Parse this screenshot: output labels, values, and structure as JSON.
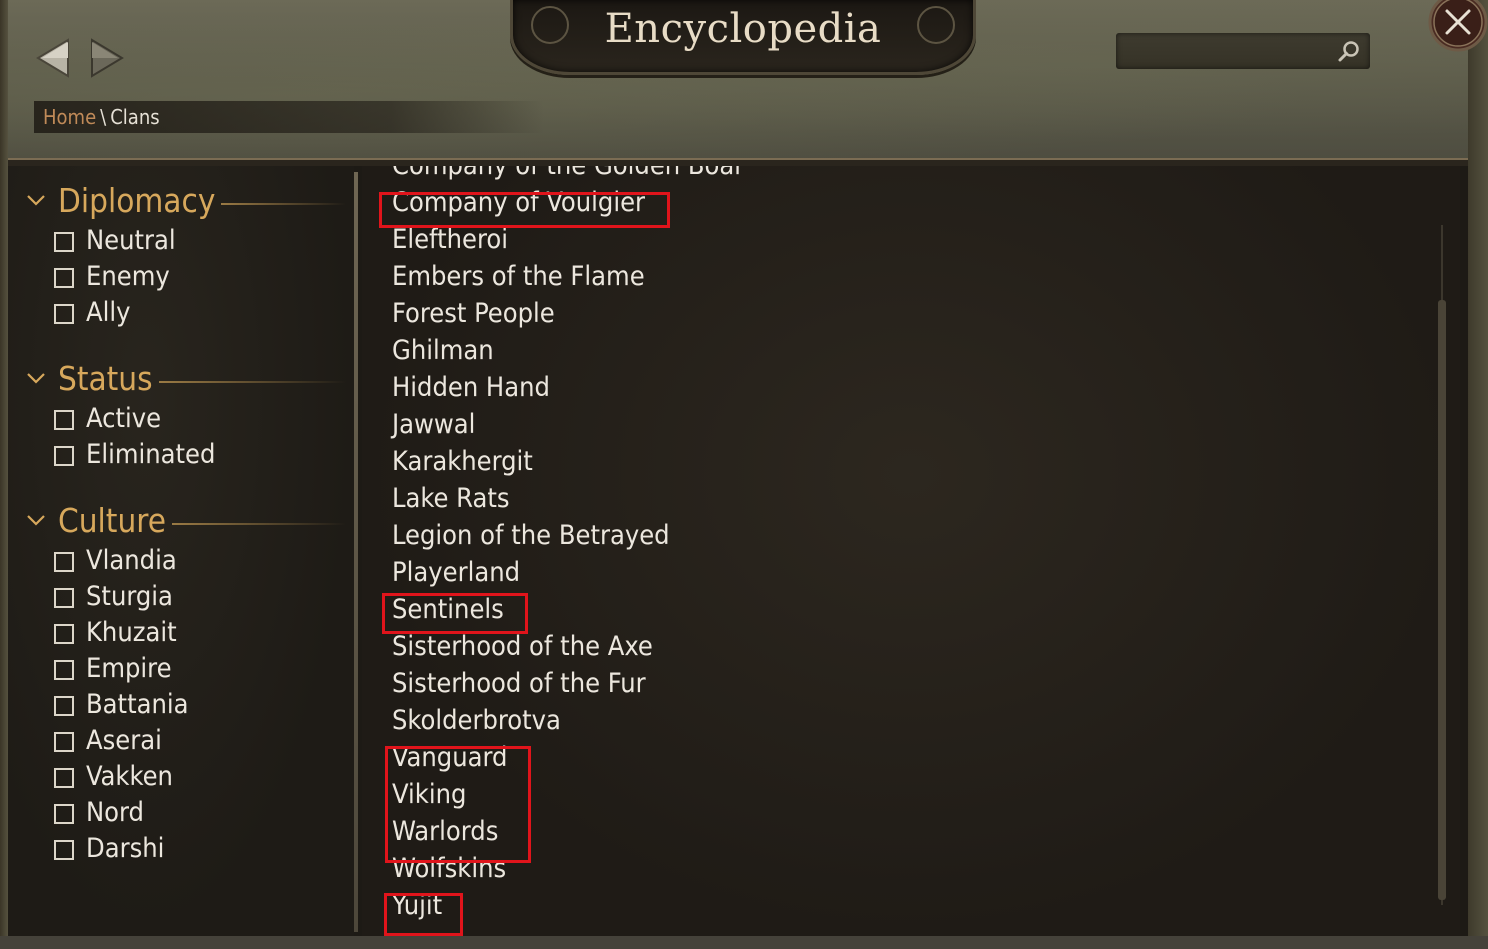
{
  "window": {
    "title": "Encyclopedia",
    "search": {
      "value": "",
      "placeholder": ""
    }
  },
  "breadcrumb": {
    "home": "Home",
    "separator": "\\",
    "current": "Clans"
  },
  "filters": {
    "diplomacy": {
      "title": "Diplomacy",
      "options": [
        "Neutral",
        "Enemy",
        "Ally"
      ]
    },
    "status": {
      "title": "Status",
      "options": [
        "Active",
        "Eliminated"
      ]
    },
    "culture": {
      "title": "Culture",
      "options": [
        "Vlandia",
        "Sturgia",
        "Khuzait",
        "Empire",
        "Battania",
        "Aserai",
        "Vakken",
        "Nord",
        "Darshi"
      ]
    }
  },
  "clans": [
    "Company of the Golden Boar",
    "Company of Voulgier",
    "Eleftheroi",
    "Embers of the Flame",
    "Forest People",
    "Ghilman",
    "Hidden Hand",
    "Jawwal",
    "Karakhergit",
    "Lake Rats",
    "Legion of the Betrayed",
    "Playerland",
    "Sentinels",
    "Sisterhood of the Axe",
    "Sisterhood of the Fur",
    "Skolderbrotva",
    "Vanguard",
    "Viking",
    "Warlords",
    "Wolfskins",
    "Yujit"
  ],
  "colors": {
    "accent_gold": "#d7a85c",
    "breadcrumb_home": "#c08a58",
    "annotation_red": "#e0141b"
  },
  "icons": {
    "back": "triangle-left-icon",
    "forward": "triangle-right-icon",
    "search": "magnifier-icon",
    "close": "x-close-icon",
    "collapse": "chevron-down-icon"
  }
}
